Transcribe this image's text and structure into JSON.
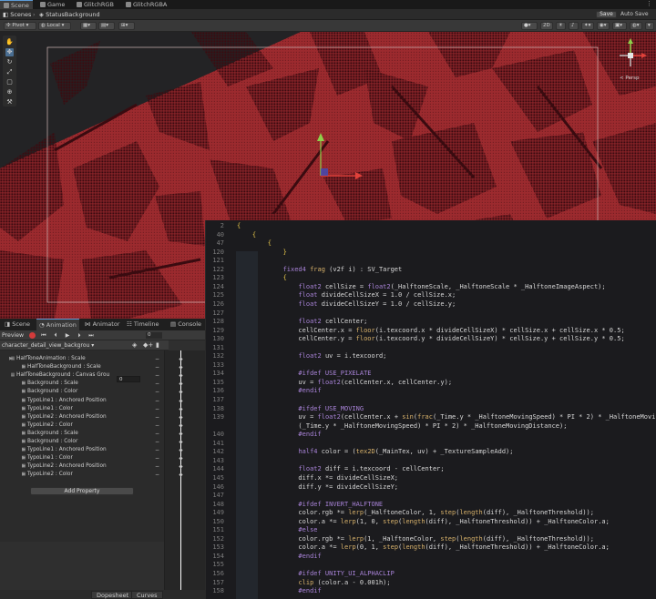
{
  "top_tabs": [
    "Scene",
    "Game",
    "GlitchRGB",
    "GlitchRGBA"
  ],
  "breadcrumb": {
    "root": "Scenes",
    "current": "StatusBackground"
  },
  "actions": {
    "save": "Save",
    "auto_save": "Auto Save"
  },
  "scene_toolbar": {
    "pivot": "Pivot",
    "space": "Local",
    "mode_2d": "2D",
    "persp_label": "< Persp"
  },
  "animation_panel": {
    "tabs": [
      "Scene",
      "Animation",
      "Animator",
      "Timeline",
      "Console"
    ],
    "preview_label": "Preview",
    "frame_value": "0",
    "clip_name": "character_detail_view_backgrou",
    "canvas_group_alpha": "0",
    "add_property_label": "Add Property",
    "bottom_tabs": [
      "Dopesheet",
      "Curves"
    ],
    "properties": [
      {
        "label": "HalfToneAnimation : Scale",
        "indent": 0,
        "arrow": "▶"
      },
      {
        "label": "HalfToneBackground : Scale",
        "indent": 1,
        "arrow": "▶"
      },
      {
        "label": "HalfToneBackground : Canvas Grou",
        "indent": 0,
        "arrow": ""
      },
      {
        "label": "Background : Scale",
        "indent": 1,
        "arrow": "▶"
      },
      {
        "label": "Background : Color",
        "indent": 1,
        "arrow": "▶"
      },
      {
        "label": "TypoLine1 : Anchored Position",
        "indent": 1,
        "arrow": "▶"
      },
      {
        "label": "TypoLine1 : Color",
        "indent": 1,
        "arrow": "▶"
      },
      {
        "label": "TypoLine2 : Anchored Position",
        "indent": 1,
        "arrow": "▶"
      },
      {
        "label": "TypoLine2 : Color",
        "indent": 1,
        "arrow": "▶"
      },
      {
        "label": "Background : Scale",
        "indent": 1,
        "arrow": "▶"
      },
      {
        "label": "Background : Color",
        "indent": 1,
        "arrow": "▶"
      },
      {
        "label": "TypoLine1 : Anchored Position",
        "indent": 1,
        "arrow": "▶"
      },
      {
        "label": "TypoLine1 : Color",
        "indent": 1,
        "arrow": "▶"
      },
      {
        "label": "TypoLine2 : Anchored Position",
        "indent": 1,
        "arrow": "▶"
      },
      {
        "label": "TypoLine2 : Color",
        "indent": 1,
        "arrow": "▶"
      }
    ]
  },
  "code_editor": {
    "lines": [
      {
        "n": "2",
        "t": "{"
      },
      {
        "n": "40",
        "t": "    {"
      },
      {
        "n": "47",
        "t": "        {"
      },
      {
        "n": "120",
        "t": "            }"
      },
      {
        "n": "121",
        "t": ""
      },
      {
        "n": "122",
        "t": "            fixed4 frag (v2f i) : SV_Target"
      },
      {
        "n": "123",
        "t": "            {"
      },
      {
        "n": "124",
        "t": "                float2 cellSize = float2(_HalftoneScale, _HalftoneScale * _HalftoneImageAspect);"
      },
      {
        "n": "125",
        "t": "                float divideCellSizeX = 1.0 / cellSize.x;"
      },
      {
        "n": "126",
        "t": "                float divideCellSizeY = 1.0 / cellSize.y;"
      },
      {
        "n": "127",
        "t": ""
      },
      {
        "n": "128",
        "t": "                float2 cellCenter;"
      },
      {
        "n": "129",
        "t": "                cellCenter.x = floor(i.texcoord.x * divideCellSizeX) * cellSize.x + cellSize.x * 0.5;"
      },
      {
        "n": "130",
        "t": "                cellCenter.y = floor(i.texcoord.y * divideCellSizeY) * cellSize.y + cellSize.y * 0.5;"
      },
      {
        "n": "131",
        "t": ""
      },
      {
        "n": "132",
        "t": "                float2 uv = i.texcoord;"
      },
      {
        "n": "133",
        "t": ""
      },
      {
        "n": "134",
        "t": "                #ifdef USE_PIXELATE"
      },
      {
        "n": "135",
        "t": "                uv = float2(cellCenter.x, cellCenter.y);"
      },
      {
        "n": "136",
        "t": "                #endif"
      },
      {
        "n": "137",
        "t": ""
      },
      {
        "n": "138",
        "t": "                #ifdef USE_MOVING"
      },
      {
        "n": "139",
        "t": "                uv = float2(cellCenter.x + sin(frac(_Time.y * _HalftoneMovingSpeed) * PI * 2) * _HalftoneMovin"
      },
      {
        "n": "",
        "t": "                (_Time.y * _HalftoneMovingSpeed) * PI * 2) * _HalftoneMovingDistance);"
      },
      {
        "n": "140",
        "t": "                #endif"
      },
      {
        "n": "141",
        "t": ""
      },
      {
        "n": "142",
        "t": "                half4 color = (tex2D(_MainTex, uv) + _TextureSampleAdd);"
      },
      {
        "n": "143",
        "t": ""
      },
      {
        "n": "144",
        "t": "                float2 diff = i.texcoord - cellCenter;"
      },
      {
        "n": "145",
        "t": "                diff.x *= divideCellSizeX;"
      },
      {
        "n": "146",
        "t": "                diff.y *= divideCellSizeY;"
      },
      {
        "n": "147",
        "t": ""
      },
      {
        "n": "148",
        "t": "                #ifdef INVERT_HALFTONE"
      },
      {
        "n": "149",
        "t": "                color.rgb *= lerp(_HalftoneColor, 1, step(length(diff), _HalftoneThreshold));"
      },
      {
        "n": "150",
        "t": "                color.a *= lerp(1, 0, step(length(diff), _HalftoneThreshold)) + _HalftoneColor.a;"
      },
      {
        "n": "151",
        "t": "                #else"
      },
      {
        "n": "152",
        "t": "                color.rgb *= lerp(1, _HalftoneColor, step(length(diff), _HalftoneThreshold));"
      },
      {
        "n": "153",
        "t": "                color.a *= lerp(0, 1, step(length(diff), _HalftoneThreshold)) + _HalftoneColor.a;"
      },
      {
        "n": "154",
        "t": "                #endif"
      },
      {
        "n": "155",
        "t": ""
      },
      {
        "n": "156",
        "t": "                #ifdef UNITY_UI_ALPHACLIP"
      },
      {
        "n": "157",
        "t": "                clip (color.a - 0.001h);"
      },
      {
        "n": "158",
        "t": "                #endif"
      }
    ]
  },
  "colors": {
    "scene_red": "#9c2a2e",
    "halftone_dot": "#3a0b10",
    "editor_bg": "#1b1b1e",
    "record_red": "#d23b3b"
  }
}
